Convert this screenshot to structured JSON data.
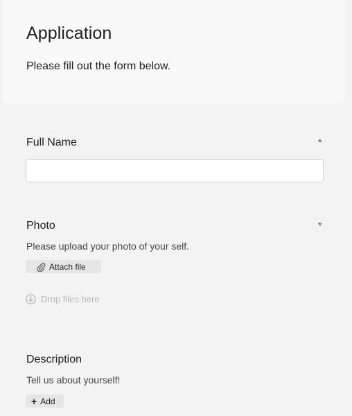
{
  "header": {
    "title": "Application",
    "subtitle": "Please fill out the form below."
  },
  "fields": {
    "full_name": {
      "label": "Full Name",
      "required_marker": "*",
      "value": "",
      "placeholder": ""
    },
    "photo": {
      "label": "Photo",
      "required_marker": "*",
      "help": "Please upload your photo of your self.",
      "attach_label": "Attach file",
      "attach_icon": "paperclip-icon",
      "drop_label": "Drop files here",
      "drop_icon": "download-circle-icon"
    },
    "description": {
      "label": "Description",
      "help": "Tell us about yourself!",
      "add_label": "Add",
      "add_icon": "plus-icon"
    }
  },
  "colors": {
    "background": "#f3f3f3",
    "header_card": "#f9f9f9",
    "text": "#1f1f1f",
    "button_bg": "#e6e6e6",
    "muted": "#b8b8b8"
  }
}
